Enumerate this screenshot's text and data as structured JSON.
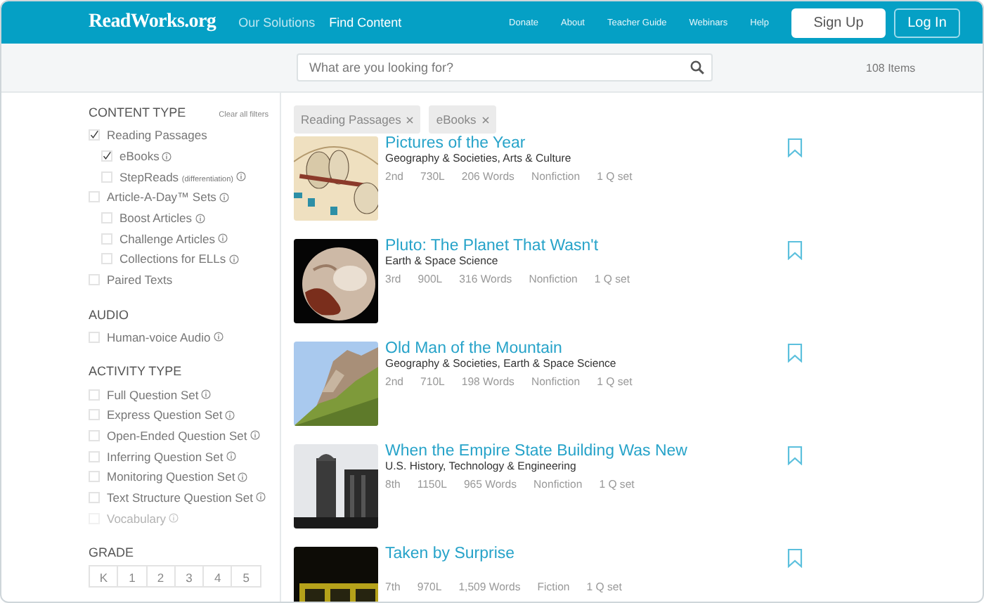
{
  "header": {
    "logo": "ReadWorks.org",
    "nav": [
      {
        "label": "Our Solutions",
        "selected": false
      },
      {
        "label": "Find Content",
        "selected": true
      }
    ],
    "links": [
      "Donate",
      "About",
      "Teacher Guide",
      "Webinars",
      "Help"
    ],
    "buttons": [
      {
        "label": "Sign Up",
        "kind": "filled"
      },
      {
        "label": "Log In",
        "kind": "outline"
      }
    ]
  },
  "search": {
    "placeholder": "What are you looking for?",
    "count": "108 Items"
  },
  "sidebar": {
    "clear_all": "Clear all filters",
    "sections": [
      {
        "title": "CONTENT TYPE",
        "filters": [
          {
            "label": "Reading Passages",
            "checked": true,
            "info": false,
            "disabled": false,
            "children": [
              {
                "label": "eBooks",
                "checked": true,
                "info": true,
                "disabled": false
              },
              {
                "label": "StepReads",
                "note": "(differentiation)",
                "checked": false,
                "info": true,
                "disabled": false
              }
            ]
          },
          {
            "label": "Article-A-Day™ Sets",
            "checked": false,
            "info": true,
            "disabled": false,
            "children": [
              {
                "label": "Boost Articles",
                "checked": false,
                "info": true,
                "disabled": false
              },
              {
                "label": "Challenge Articles",
                "checked": false,
                "info": true,
                "disabled": false
              },
              {
                "label": "Collections for ELLs",
                "checked": false,
                "info": true,
                "disabled": false
              }
            ]
          },
          {
            "label": "Paired Texts",
            "checked": false,
            "info": false,
            "disabled": false
          }
        ]
      },
      {
        "title": "AUDIO",
        "filters": [
          {
            "label": "Human-voice Audio",
            "checked": false,
            "info": true,
            "disabled": false
          }
        ]
      },
      {
        "title": "ACTIVITY TYPE",
        "filters": [
          {
            "label": "Full Question Set",
            "checked": false,
            "info": true,
            "disabled": false
          },
          {
            "label": "Express Question Set",
            "checked": false,
            "info": true,
            "disabled": false
          },
          {
            "label": "Open-Ended Question Set",
            "checked": false,
            "info": true,
            "disabled": false
          },
          {
            "label": "Inferring Question Set",
            "checked": false,
            "info": true,
            "disabled": false
          },
          {
            "label": "Monitoring Question Set",
            "checked": false,
            "info": true,
            "disabled": false
          },
          {
            "label": "Text Structure Question Set",
            "checked": false,
            "info": true,
            "disabled": false
          },
          {
            "label": "Vocabulary",
            "checked": false,
            "info": true,
            "disabled": true
          }
        ]
      }
    ],
    "grade": {
      "title": "GRADE",
      "options": [
        "K",
        "1",
        "2",
        "3",
        "4",
        "5"
      ]
    }
  },
  "active_filters": [
    "Reading Passages",
    "eBooks"
  ],
  "results": [
    {
      "title": "Pictures of the Year",
      "subjects": "Geography & Societies, Arts & Culture",
      "meta": [
        "2nd",
        "730L",
        "206 Words",
        "Nonfiction",
        "1 Q set"
      ]
    },
    {
      "title": "Pluto: The Planet That Wasn't",
      "subjects": "Earth & Space Science",
      "meta": [
        "3rd",
        "900L",
        "316 Words",
        "Nonfiction",
        "1 Q set"
      ]
    },
    {
      "title": "Old Man of the Mountain",
      "subjects": "Geography & Societies, Earth & Space Science",
      "meta": [
        "2nd",
        "710L",
        "198 Words",
        "Nonfiction",
        "1 Q set"
      ]
    },
    {
      "title": "When the Empire State Building Was New",
      "subjects": "U.S. History, Technology & Engineering",
      "meta": [
        "8th",
        "1150L",
        "965 Words",
        "Nonfiction",
        "1 Q set"
      ]
    },
    {
      "title": "Taken by Surprise",
      "meta": [
        "7th",
        "970L",
        "1,509 Words",
        "Fiction",
        "1 Q set"
      ]
    }
  ]
}
